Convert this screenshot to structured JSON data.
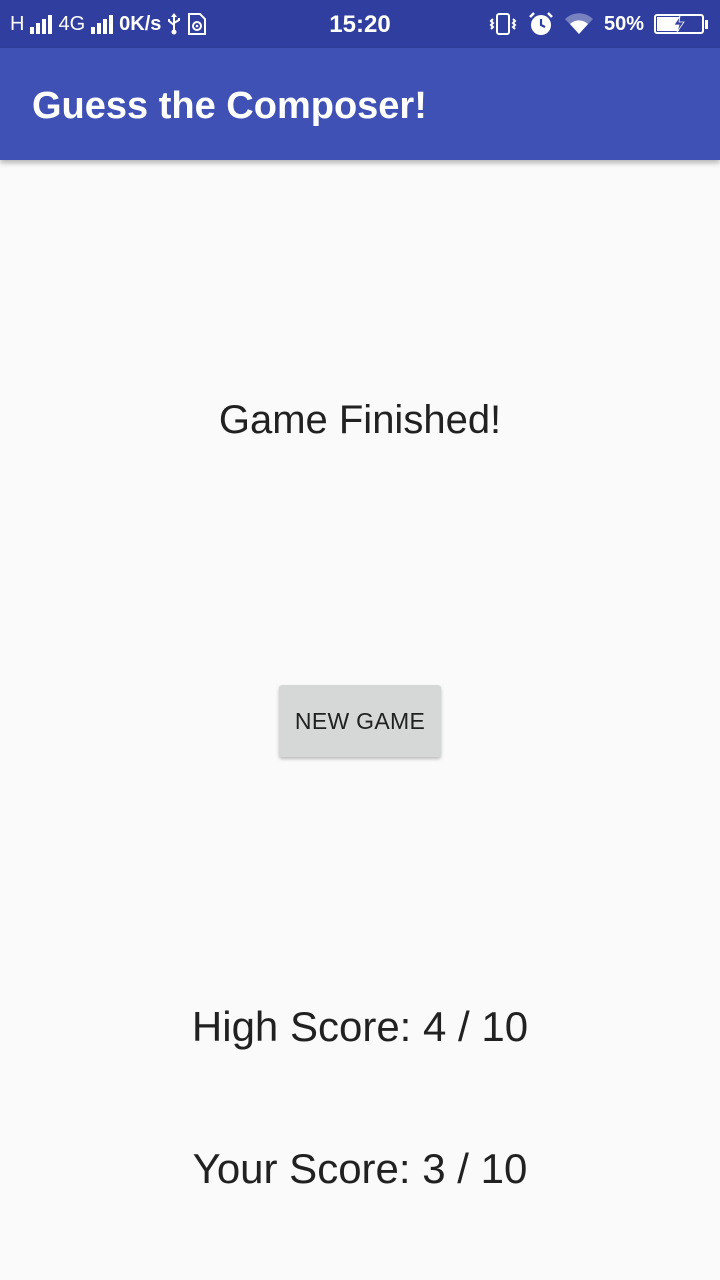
{
  "status_bar": {
    "network_h": "H",
    "network_4g": "4G",
    "data_speed": "0K/s",
    "time": "15:20",
    "battery_percent": "50%",
    "battery_level": 0.5,
    "icons": [
      "signal-icon",
      "usb-icon",
      "sim-settings-icon",
      "vibrate-icon",
      "alarm-icon",
      "wifi-icon",
      "battery-charging-icon"
    ]
  },
  "app_bar": {
    "title": "Guess the Composer!"
  },
  "main": {
    "heading": "Game Finished!",
    "new_game_label": "NEW GAME",
    "high_score": "High Score: 4 / 10",
    "your_score": "Your Score: 3 / 10"
  },
  "colors": {
    "status_bar": "#303f9f",
    "app_bar": "#3f51b5",
    "background": "#fafafa",
    "button": "#d6d7d7",
    "text": "#212121"
  }
}
